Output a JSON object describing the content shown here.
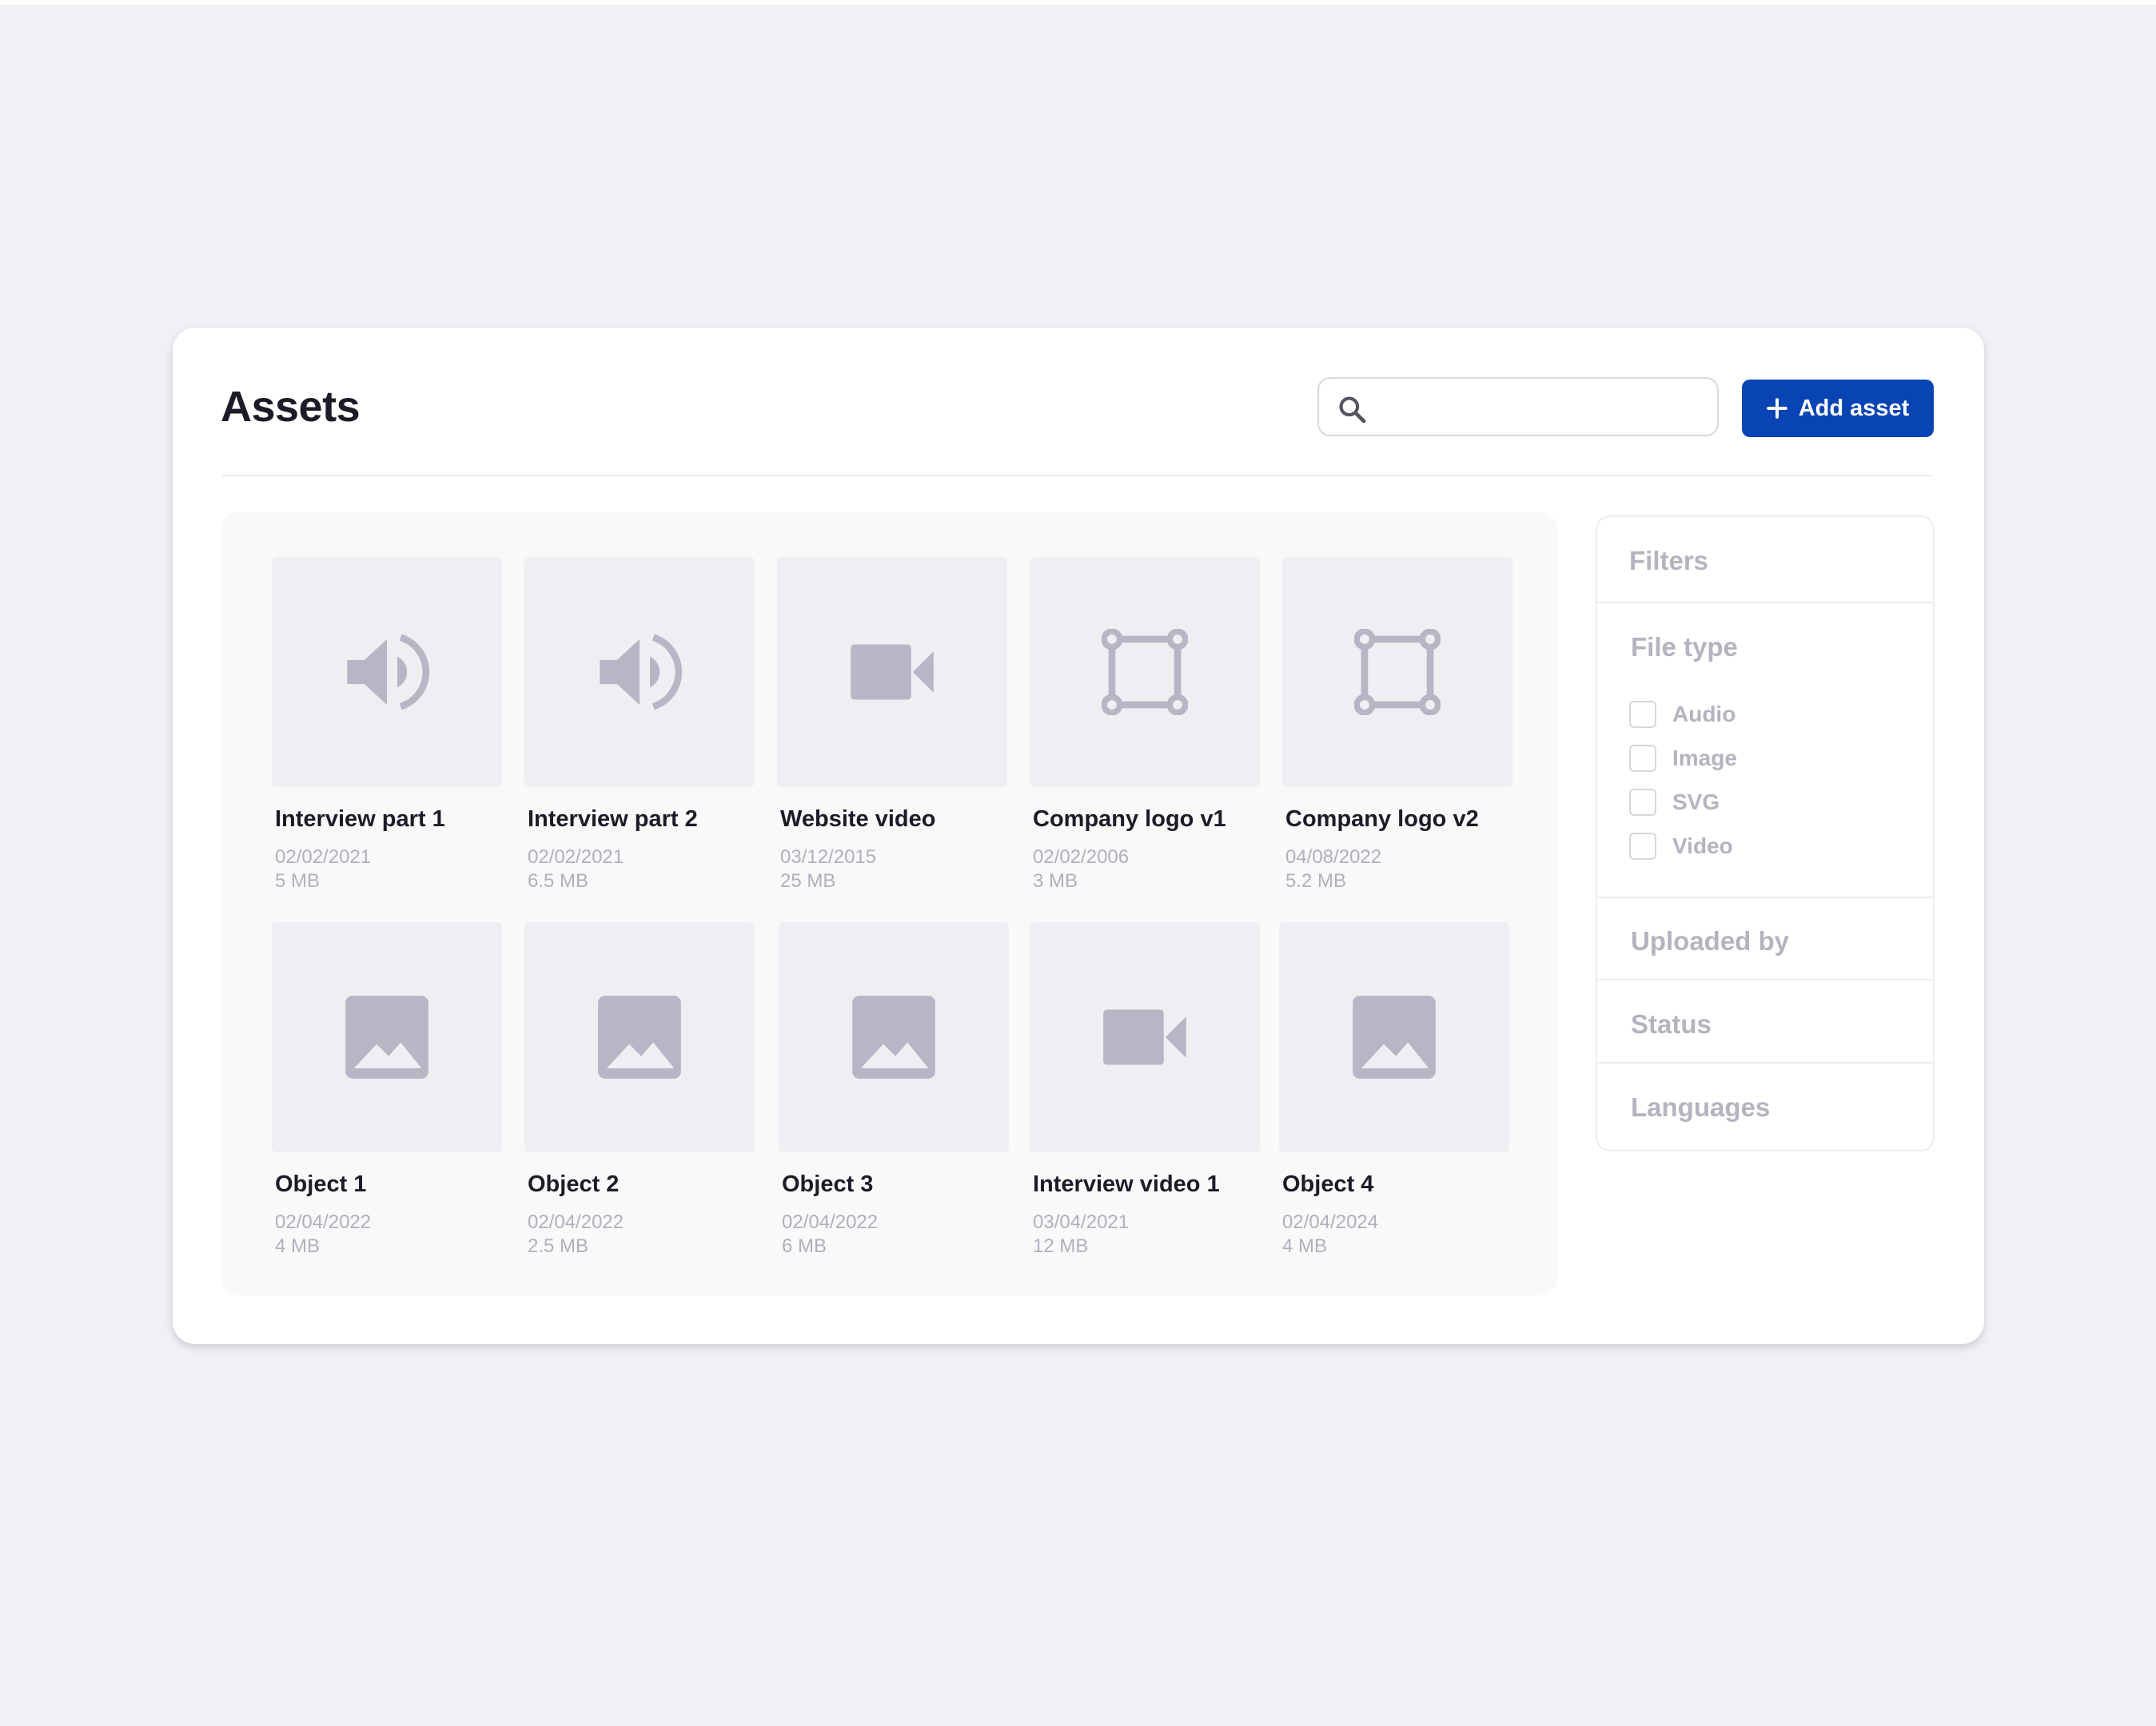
{
  "header": {
    "title": "Assets",
    "search_placeholder": "",
    "search_value": "",
    "add_button_label": "Add asset"
  },
  "colors": {
    "accent": "#0844b4",
    "background": "#f0f0f5",
    "icon": "#b6b6c4"
  },
  "assets": [
    {
      "name": "Interview part 1",
      "date": "02/02/2021",
      "size": "5 MB",
      "icon": "speaker-icon"
    },
    {
      "name": "Interview part 2",
      "date": "02/02/2021",
      "size": "6.5 MB",
      "icon": "speaker-icon"
    },
    {
      "name": "Website video",
      "date": "03/12/2015",
      "size": "25 MB",
      "icon": "video-camera-icon"
    },
    {
      "name": "Company logo v1",
      "date": "02/02/2006",
      "size": "3 MB",
      "icon": "vector-shape-icon"
    },
    {
      "name": "Company logo v2",
      "date": "04/08/2022",
      "size": "5.2 MB",
      "icon": "vector-shape-icon"
    },
    {
      "name": "Object 1",
      "date": "02/04/2022",
      "size": "4 MB",
      "icon": "image-icon"
    },
    {
      "name": "Object 2",
      "date": "02/04/2022",
      "size": "2.5 MB",
      "icon": "image-icon"
    },
    {
      "name": "Object 3",
      "date": "02/04/2022",
      "size": "6 MB",
      "icon": "image-icon"
    },
    {
      "name": "Interview video 1",
      "date": "03/04/2021",
      "size": "12 MB",
      "icon": "video-camera-icon"
    },
    {
      "name": "Object 4",
      "date": "02/04/2024",
      "size": "4 MB",
      "icon": "image-icon"
    }
  ],
  "filters": {
    "heading": "Filters",
    "file_type": {
      "label": "File type",
      "options": [
        {
          "label": "Audio",
          "checked": false
        },
        {
          "label": "Image",
          "checked": false
        },
        {
          "label": "SVG",
          "checked": false
        },
        {
          "label": "Video",
          "checked": false
        }
      ]
    },
    "uploaded_by": "Uploaded by",
    "status": "Status",
    "languages": "Languages"
  }
}
